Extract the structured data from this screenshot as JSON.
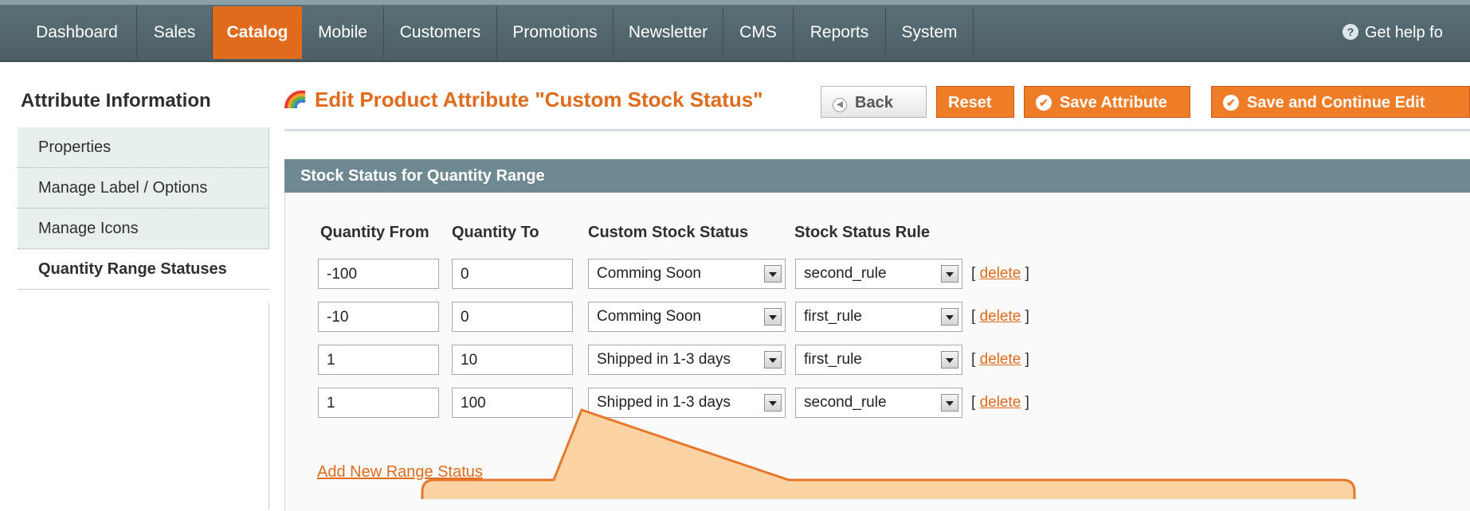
{
  "nav": {
    "items": [
      "Dashboard",
      "Sales",
      "Catalog",
      "Mobile",
      "Customers",
      "Promotions",
      "Newsletter",
      "CMS",
      "Reports",
      "System"
    ],
    "active": "Catalog",
    "help_label": "Get help fo"
  },
  "sidebar": {
    "title": "Attribute Information",
    "tabs": [
      "Properties",
      "Manage Label / Options",
      "Manage Icons",
      "Quantity Range Statuses"
    ],
    "active_tab": "Quantity Range Statuses"
  },
  "header": {
    "title": "Edit Product Attribute \"Custom Stock Status\"",
    "buttons": {
      "back": "Back",
      "reset": "Reset",
      "save": "Save Attribute",
      "save_continue": "Save and Continue Edit"
    }
  },
  "section": {
    "title": "Stock Status for Quantity Range",
    "columns": [
      "Quantity From",
      "Quantity To",
      "Custom Stock Status",
      "Stock Status Rule"
    ],
    "rows": [
      {
        "from": "-100",
        "to": "0",
        "status": "Comming Soon",
        "rule": "second_rule"
      },
      {
        "from": "-10",
        "to": "0",
        "status": "Comming Soon",
        "rule": "first_rule"
      },
      {
        "from": "1",
        "to": "10",
        "status": "Shipped in 1-3 days",
        "rule": "first_rule"
      },
      {
        "from": "1",
        "to": "100",
        "status": "Shipped in 1-3 days",
        "rule": "second_rule"
      }
    ],
    "delete_label": "delete",
    "add_label": "Add New Range Status"
  },
  "colors": {
    "accent": "#e06b1c",
    "nav_bg": "#51656c",
    "section_head": "#6f8992",
    "callout_fill": "#fcd3a3",
    "callout_stroke": "#e8772e"
  }
}
